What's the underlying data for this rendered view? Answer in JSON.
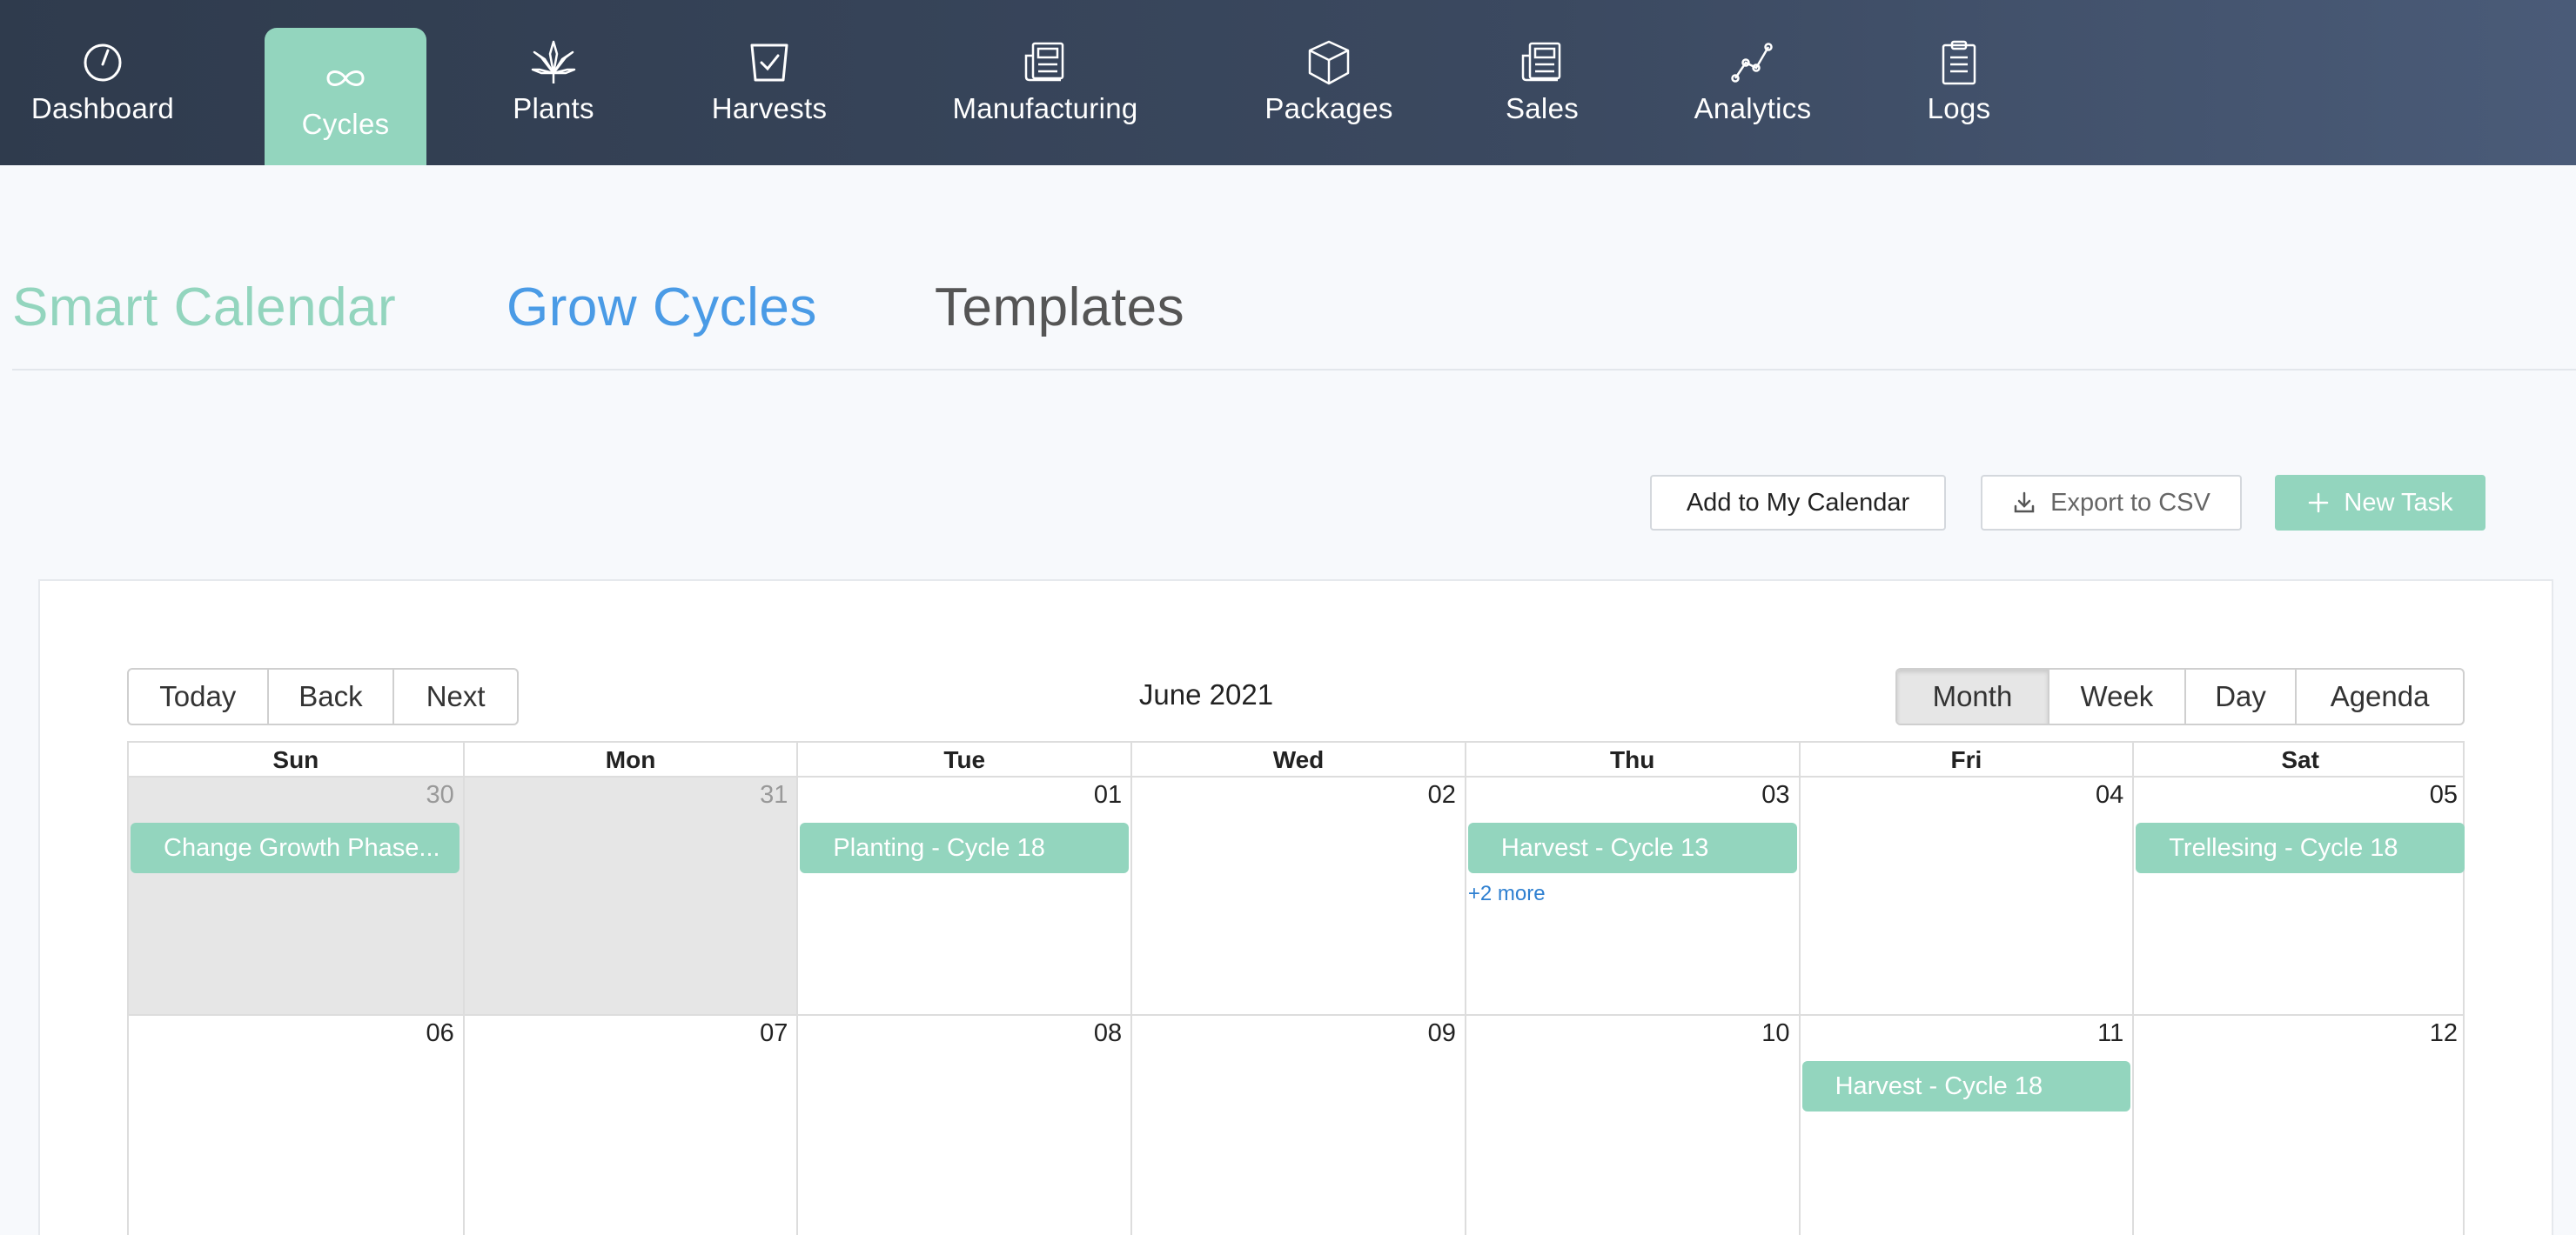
{
  "nav": {
    "items": [
      {
        "label": "Dashboard",
        "icon": "gauge-icon"
      },
      {
        "label": "Cycles",
        "icon": "infinity-icon"
      },
      {
        "label": "Plants",
        "icon": "cannabis-leaf-icon"
      },
      {
        "label": "Harvests",
        "icon": "basket-check-icon"
      },
      {
        "label": "Manufacturing",
        "icon": "newspaper-icon"
      },
      {
        "label": "Packages",
        "icon": "box-icon"
      },
      {
        "label": "Sales",
        "icon": "newspaper-icon"
      },
      {
        "label": "Analytics",
        "icon": "line-chart-icon"
      },
      {
        "label": "Logs",
        "icon": "clipboard-icon"
      }
    ],
    "active": "Cycles"
  },
  "subtabs": [
    {
      "label": "Smart Calendar",
      "color": "#93d5be"
    },
    {
      "label": "Grow Cycles",
      "color": "#4a9be6"
    },
    {
      "label": "Templates",
      "color": "#555555"
    }
  ],
  "actions": {
    "add_calendar": "Add to My Calendar",
    "export_csv": "Export to CSV",
    "new_task": "New Task"
  },
  "calendar": {
    "nav_buttons": [
      "Today",
      "Back",
      "Next"
    ],
    "label": "June 2021",
    "views": [
      "Month",
      "Week",
      "Day",
      "Agenda"
    ],
    "active_view": "Month",
    "weekdays": [
      "Sun",
      "Mon",
      "Tue",
      "Wed",
      "Thu",
      "Fri",
      "Sat"
    ],
    "weeks": [
      {
        "days": [
          {
            "num": "30",
            "off": true,
            "events": [
              "Change Growth Phase..."
            ],
            "more": ""
          },
          {
            "num": "31",
            "off": true,
            "events": [],
            "more": ""
          },
          {
            "num": "01",
            "off": false,
            "events": [
              "Planting - Cycle 18"
            ],
            "more": ""
          },
          {
            "num": "02",
            "off": false,
            "events": [],
            "more": ""
          },
          {
            "num": "03",
            "off": false,
            "events": [
              "Harvest - Cycle 13"
            ],
            "more": "+2 more"
          },
          {
            "num": "04",
            "off": false,
            "events": [],
            "more": ""
          },
          {
            "num": "05",
            "off": false,
            "events": [
              "Trellesing - Cycle 18"
            ],
            "more": ""
          }
        ]
      },
      {
        "days": [
          {
            "num": "06",
            "off": false,
            "events": [],
            "more": ""
          },
          {
            "num": "07",
            "off": false,
            "events": [],
            "more": ""
          },
          {
            "num": "08",
            "off": false,
            "events": [],
            "more": ""
          },
          {
            "num": "09",
            "off": false,
            "events": [],
            "more": ""
          },
          {
            "num": "10",
            "off": false,
            "events": [],
            "more": ""
          },
          {
            "num": "11",
            "off": false,
            "events": [
              "Harvest - Cycle 18"
            ],
            "more": ""
          },
          {
            "num": "12",
            "off": false,
            "events": [],
            "more": ""
          }
        ]
      }
    ]
  },
  "colors": {
    "accent": "#93d5be",
    "link": "#4a9be6",
    "nav_bg": "#2f3b4d"
  }
}
